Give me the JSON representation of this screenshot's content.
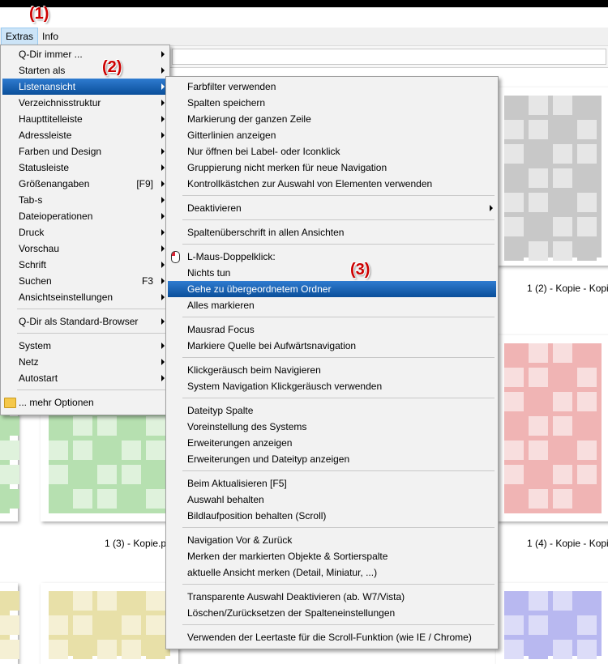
{
  "menubar": {
    "extras": "Extras",
    "info": "Info"
  },
  "annotations": {
    "one": "(1)",
    "two": "(2)",
    "three": "(3)"
  },
  "extras_menu": [
    {
      "label": "Q-Dir immer ...",
      "arrow": true
    },
    {
      "label": "Starten als",
      "arrow": true
    },
    {
      "label": "Listenansicht",
      "arrow": true,
      "highlight": true
    },
    {
      "label": "Verzeichnisstruktur",
      "arrow": true
    },
    {
      "label": "Haupttitelleiste",
      "arrow": true
    },
    {
      "label": "Adressleiste",
      "arrow": true
    },
    {
      "label": "Farben und Design",
      "arrow": true
    },
    {
      "label": "Statusleiste",
      "arrow": true
    },
    {
      "label": "Größenangaben",
      "shortcut": "[F9]",
      "arrow": true
    },
    {
      "label": "Tab-s",
      "arrow": true
    },
    {
      "label": "Dateioperationen",
      "arrow": true
    },
    {
      "label": "Druck",
      "arrow": true
    },
    {
      "label": "Vorschau",
      "arrow": true
    },
    {
      "label": "Schrift",
      "arrow": true
    },
    {
      "label": "Suchen",
      "shortcut": "F3",
      "arrow": true
    },
    {
      "label": "Ansichtseinstellungen",
      "arrow": true
    },
    {
      "sep": true
    },
    {
      "label": "Q-Dir als Standard-Browser",
      "arrow": true
    },
    {
      "sep": true
    },
    {
      "label": "System",
      "arrow": true
    },
    {
      "label": "Netz",
      "arrow": true
    },
    {
      "label": "Autostart",
      "arrow": true
    },
    {
      "sep": true
    },
    {
      "label": "... mehr Optionen",
      "icon": "folder-icon"
    }
  ],
  "sub_menu": [
    {
      "label": "Farbfilter verwenden"
    },
    {
      "label": "Spalten speichern"
    },
    {
      "label": "Markierung der ganzen Zeile"
    },
    {
      "label": "Gitterlinien anzeigen"
    },
    {
      "label": "Nur öffnen bei Label- oder Iconklick"
    },
    {
      "label": "Gruppierung nicht merken für neue Navigation"
    },
    {
      "label": "Kontrollkästchen zur Auswahl von Elementen verwenden"
    },
    {
      "sep": true
    },
    {
      "label": "Deaktivieren",
      "arrow": true
    },
    {
      "sep": true
    },
    {
      "label": "Spaltenüberschrift in allen Ansichten"
    },
    {
      "sep": true
    },
    {
      "label": "L-Maus-Doppelklick:",
      "icon": "mouse-icon"
    },
    {
      "label": "Nichts tun"
    },
    {
      "label": "Gehe zu übergeordnetem Ordner",
      "highlight": true
    },
    {
      "label": "Alles markieren"
    },
    {
      "sep": true
    },
    {
      "label": "Mausrad Focus"
    },
    {
      "label": "Markiere Quelle bei Aufwärtsnavigation"
    },
    {
      "sep": true
    },
    {
      "label": "Klickgeräusch beim Navigieren"
    },
    {
      "label": "System Navigation Klickgeräusch verwenden"
    },
    {
      "sep": true
    },
    {
      "label": "Dateityp Spalte"
    },
    {
      "label": "Voreinstellung des Systems"
    },
    {
      "label": "Erweiterungen anzeigen"
    },
    {
      "label": "Erweiterungen und Dateityp anzeigen"
    },
    {
      "sep": true
    },
    {
      "label": "Beim Aktualisieren [F5]"
    },
    {
      "label": "Auswahl behalten"
    },
    {
      "label": "Bildlaufposition behalten (Scroll)"
    },
    {
      "sep": true
    },
    {
      "label": "Navigation Vor & Zurück"
    },
    {
      "label": "Merken der markierten Objekte & Sortierspalte"
    },
    {
      "label": "aktuelle Ansicht merken (Detail, Miniatur, ...)"
    },
    {
      "sep": true
    },
    {
      "label": "Transparente Auswahl Deaktivieren (ab. W7/Vista)"
    },
    {
      "label": "Löschen/Zurücksetzen der Spalteneinstellungen"
    },
    {
      "sep": true
    },
    {
      "label": "Verwenden der Leertaste für die Scroll-Funktion (wie IE / Chrome)"
    }
  ],
  "thumbnails": [
    {
      "caption": "1 (2) - Kopie - Kopi",
      "color": "#c8c8c8",
      "light": "#e6e6e6"
    },
    {
      "caption": "1 (3) - Kopie.p",
      "color": "#b6e0b0",
      "light": "#dff2dc"
    },
    {
      "caption": "1 (4) - Kopie - Kopi",
      "color": "#f0b4b4",
      "light": "#f8dede"
    },
    {
      "caption": "",
      "color": "#e8e0a8",
      "light": "#f5f0d4"
    },
    {
      "caption": "",
      "color": "#b8b8f0",
      "light": "#dcdcf8"
    }
  ]
}
